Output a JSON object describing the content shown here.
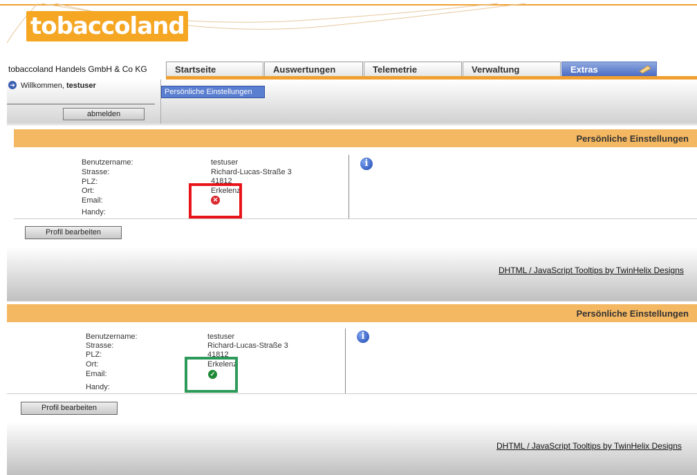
{
  "brand": {
    "logo_text": "tobaccoland"
  },
  "company": "tobaccoland Handels GmbH & Co KG",
  "nav": {
    "tabs": [
      {
        "label": "Startseite"
      },
      {
        "label": "Auswertungen"
      },
      {
        "label": "Telemetrie"
      },
      {
        "label": "Verwaltung"
      },
      {
        "label": "Extras"
      }
    ]
  },
  "user": {
    "welcome_prefix": "Willkommen, ",
    "username": "testuser",
    "logout_label": "abmelden"
  },
  "subnav": {
    "active_label": "Persönliche Einstellungen"
  },
  "panel1": {
    "title": "Persönliche Einstellungen",
    "labels": [
      "Benutzername:",
      "Strasse:",
      "PLZ:",
      "Ort:",
      "Email:",
      "Handy:"
    ],
    "values": {
      "username": "testuser",
      "street": "Richard-Lucas-Straße 3",
      "zip": "41812",
      "city": "Erkelenz"
    },
    "email_status": "invalid",
    "highlight_color": "#e8141a",
    "edit_label": "Profil bearbeiten"
  },
  "panel2": {
    "title": "Persönliche Einstellungen",
    "labels": [
      "Benutzername:",
      "Strasse:",
      "PLZ:",
      "Ort:",
      "Email:",
      "Handy:"
    ],
    "values": {
      "username": "testuser",
      "street": "Richard-Lucas-Straße 3",
      "zip": "41812",
      "city": "Erkelenz"
    },
    "email_status": "valid",
    "highlight_color": "#2e9a5a",
    "edit_label": "Profil bearbeiten"
  },
  "footer": {
    "link": "DHTML / JavaScript Tooltips by TwinHelix Designs"
  },
  "colors": {
    "accent": "#f5a623",
    "header_bar": "#f5b862",
    "active_tab": "#4a6cc4"
  },
  "icons": {
    "info": "info-icon",
    "error": "error-icon",
    "ok": "check-icon"
  }
}
